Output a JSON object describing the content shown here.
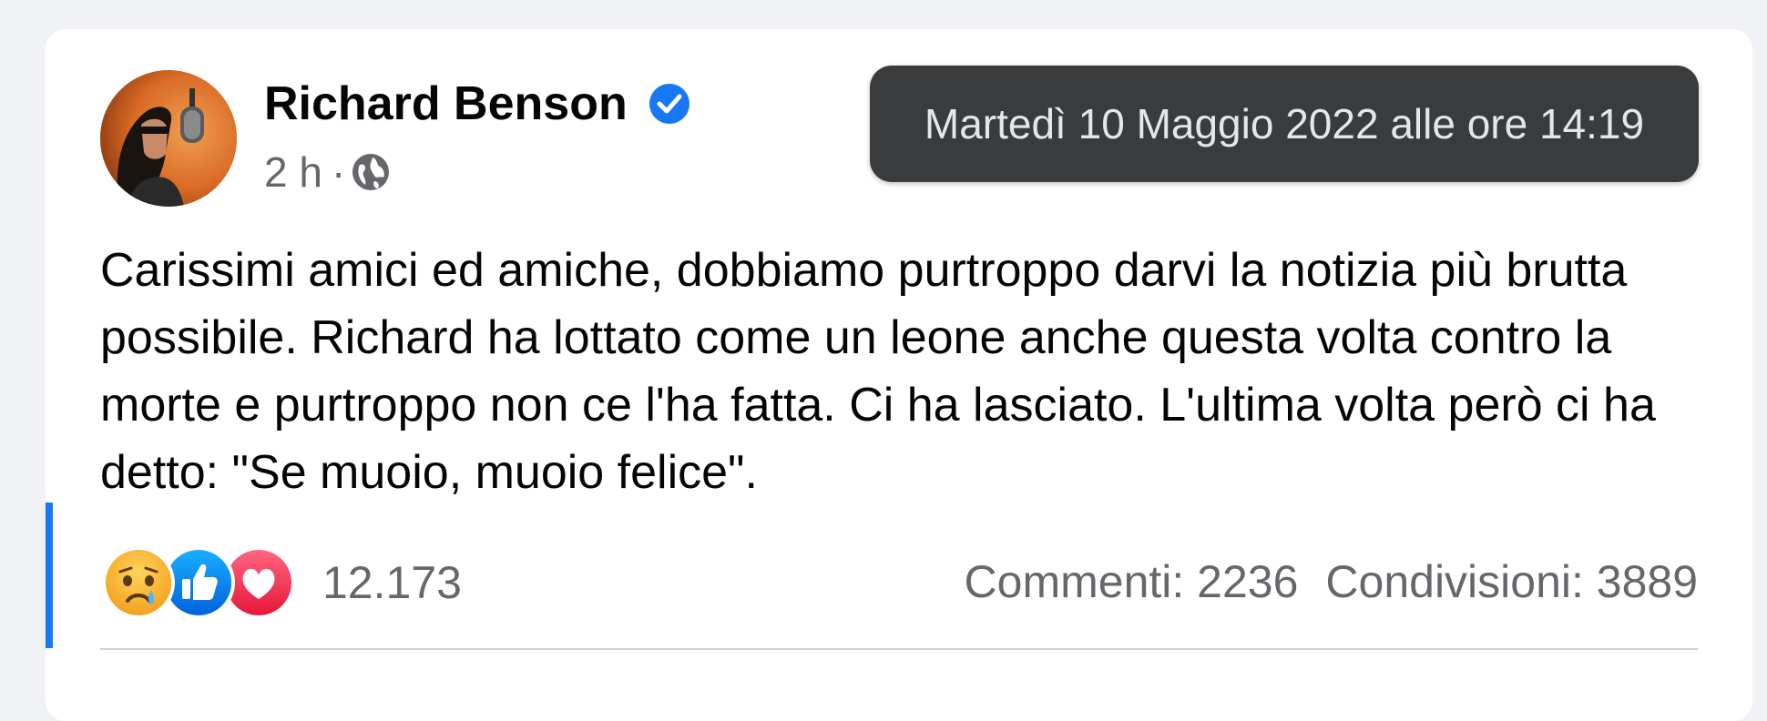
{
  "post": {
    "author_name": "Richard Benson",
    "time_ago": "2 h",
    "separator": "·",
    "privacy_icon": "globe-icon",
    "verified_icon": "verified-badge-icon",
    "tooltip_timestamp": "Martedì 10 Maggio 2022 alle ore 14:19",
    "text": "Carissimi amici ed amiche, dobbiamo purtroppo darvi la notizia più brutta possibile. Richard ha lottato come un leone anche questa volta contro la morte e purtroppo non ce l'ha fatta. Ci ha lasciato. L'ultima volta però ci ha detto: \"Se muoio, muoio felice\"."
  },
  "reactions": {
    "icons": [
      "sad-reaction-icon",
      "like-reaction-icon",
      "love-reaction-icon"
    ],
    "count": "12.173"
  },
  "stats": {
    "comments_label": "Commenti: 2236",
    "shares_label": "Condivisioni: 3889"
  },
  "colors": {
    "accent": "#1877f2",
    "tooltip_bg": "#3a3b3c",
    "love": "#f33e58",
    "sad": "#f7b125"
  }
}
